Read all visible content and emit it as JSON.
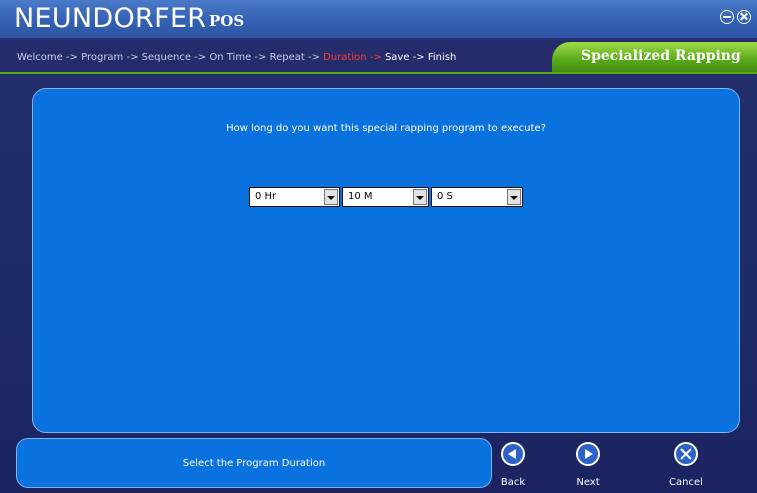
{
  "app": {
    "brand": "NEUNDORFER",
    "brand_sub": "POS"
  },
  "breadcrumb": {
    "steps": [
      "Welcome",
      "Program",
      "Sequence",
      "On Time",
      "Repeat",
      "Duration",
      "Save",
      "Finish"
    ],
    "separator": " -> ",
    "current_index": 5
  },
  "wizard": {
    "title": "Specialized Rapping"
  },
  "question": "How long do you want this special rapping program to execute?",
  "duration": {
    "hours": "0 Hr",
    "minutes": "10 M",
    "seconds": "0 S"
  },
  "status_message": "Select the Program Duration",
  "nav": {
    "back": "Back",
    "next": "Next",
    "cancel": "Cancel"
  },
  "icons": {
    "minimize": "minimize-icon",
    "close": "close-icon",
    "back": "back-arrow-icon",
    "next": "next-arrow-icon",
    "cancel": "cancel-x-icon"
  },
  "colors": {
    "accent_green": "#5aa81a",
    "current_step": "#ff3b30",
    "panel_blue": "#0a72de"
  }
}
